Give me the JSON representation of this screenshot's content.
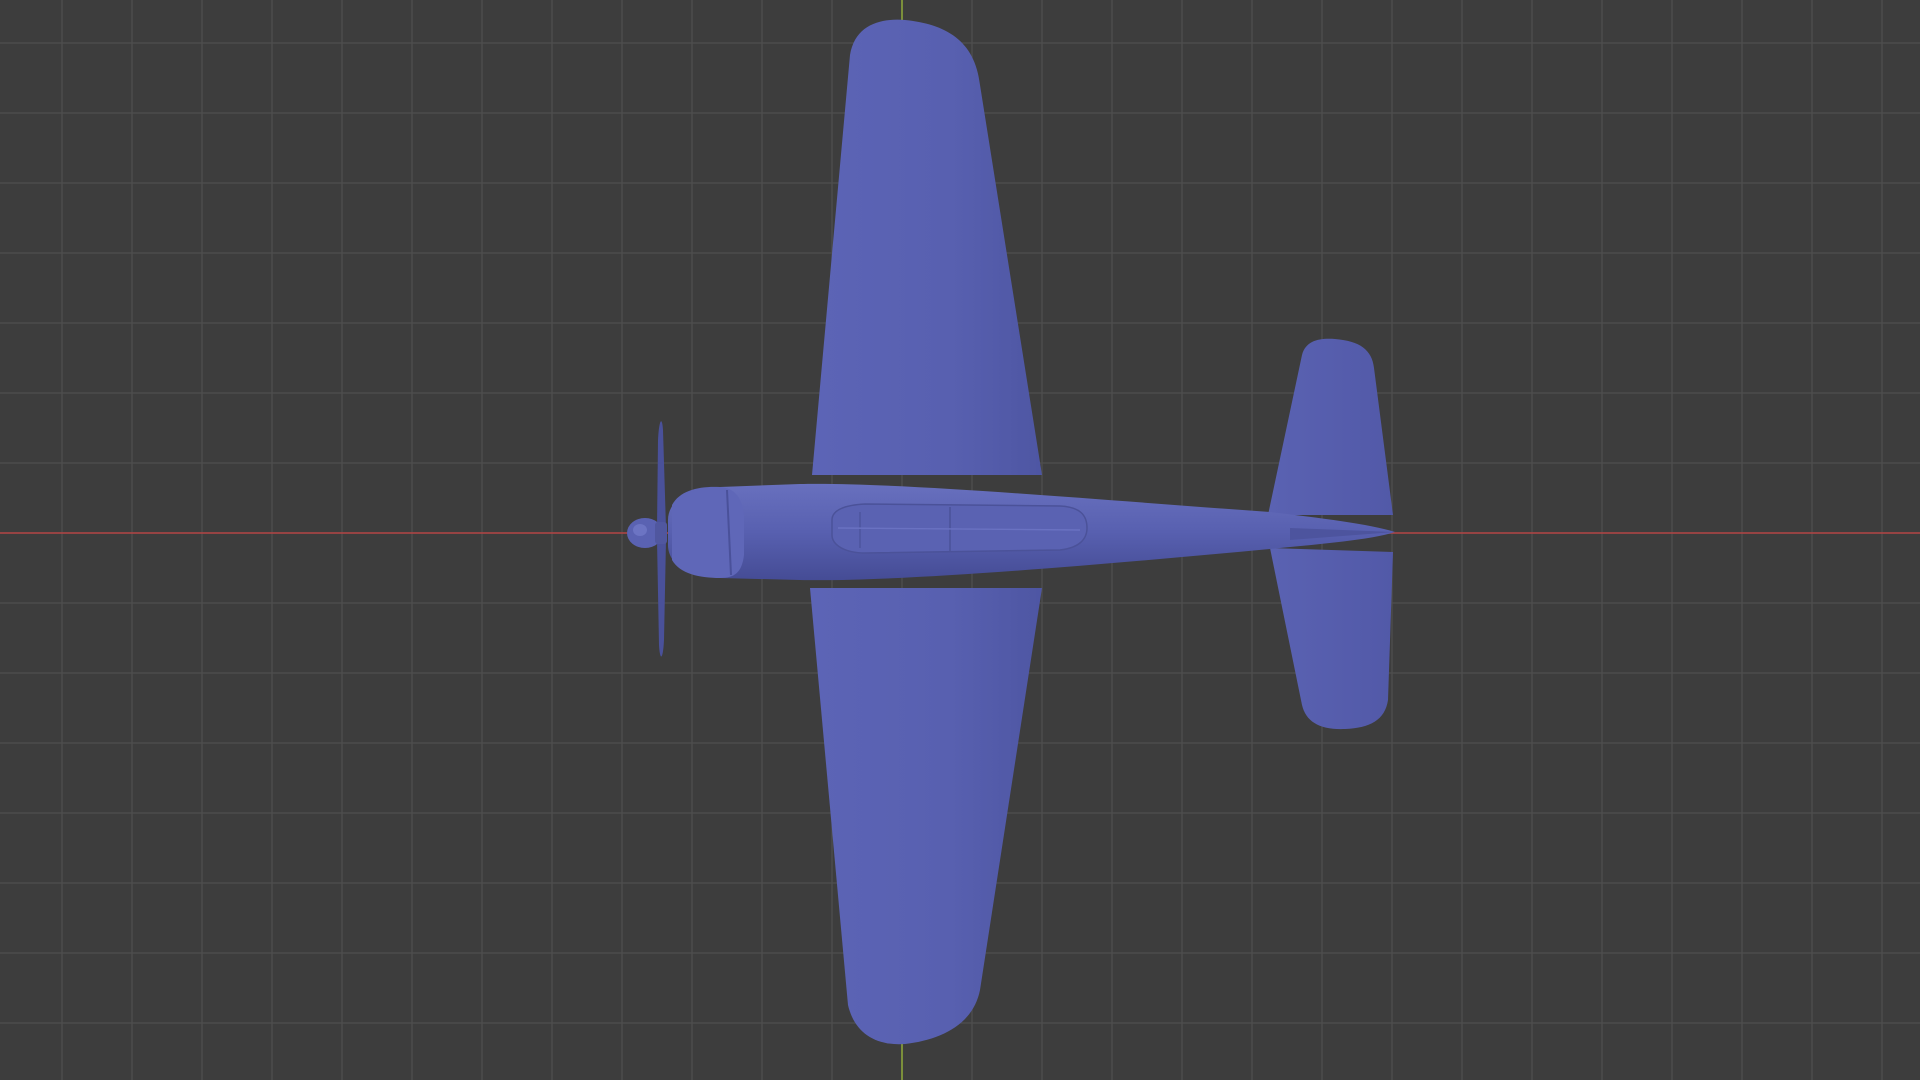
{
  "app": {
    "name": "",
    "view": "3D Viewport"
  },
  "viewport": {
    "background_color": "#3d3d3d",
    "grid": true,
    "grid_line_color": "#4f4f4f",
    "x_axis_color": "#b24444",
    "y_axis_color": "#8aa33a",
    "model_color": "#5a62b3",
    "model_name": "aircraft"
  }
}
